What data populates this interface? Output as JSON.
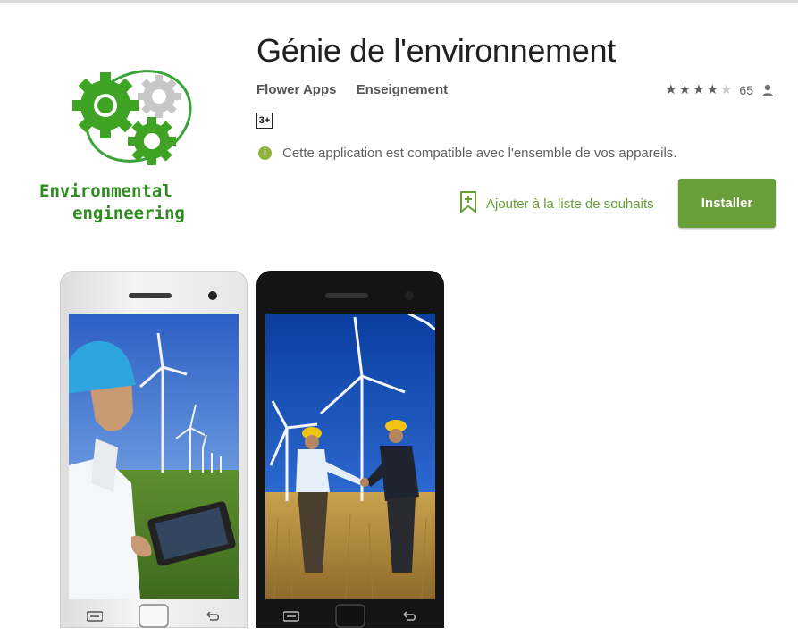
{
  "app": {
    "title": "Génie de l'environnement",
    "developer": "Flower Apps",
    "category": "Enseignement",
    "content_rating": "3+",
    "rating_count": "65",
    "rating_stars": 4.5,
    "compat_message": "Cette application est compatible avec l'ensemble de vos appareils.",
    "wishlist_label": "Ajouter à la liste de souhaits",
    "install_label": "Installer"
  },
  "icon": {
    "caption_line1": "Environmental",
    "caption_line2": "engineering"
  },
  "colors": {
    "accent_green": "#689f38",
    "icon_green": "#2e8b1f",
    "info_green": "#8bb536",
    "text_dark": "#212121",
    "text_gray": "#616161"
  },
  "icons": [
    "star-icon",
    "person-icon",
    "info-icon",
    "bookmark-add-icon",
    "menu-icon",
    "home-icon",
    "back-icon"
  ]
}
